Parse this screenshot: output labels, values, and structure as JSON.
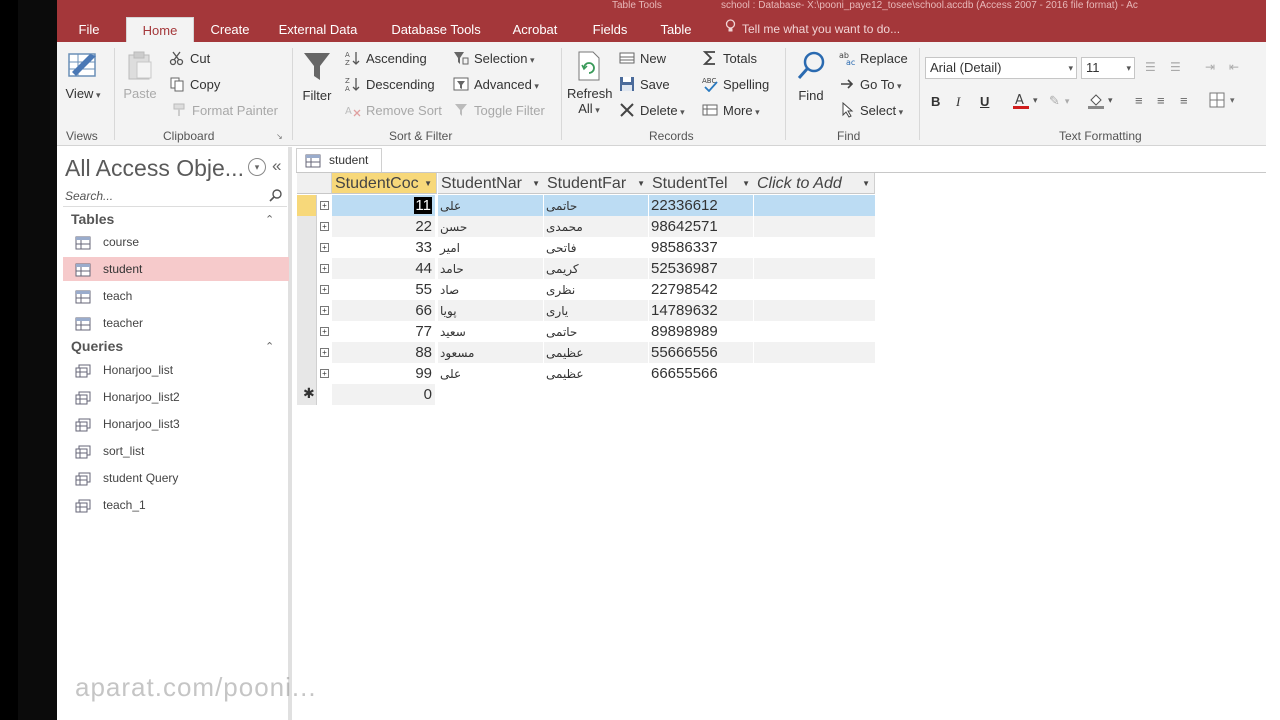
{
  "titlebar": {
    "context_tab_title": "Table Tools",
    "window_title": "school : Database- X:\\pooni_paye12_tosee\\school.accdb (Access 2007 - 2016 file format) - Ac"
  },
  "tabs": [
    "File",
    "Home",
    "Create",
    "External Data",
    "Database Tools",
    "Acrobat",
    "Fields",
    "Table"
  ],
  "active_tab": "Home",
  "tell_me": "Tell me what you want to do...",
  "ribbon": {
    "views": {
      "view": "View",
      "group": "Views"
    },
    "clipboard": {
      "paste": "Paste",
      "cut": "Cut",
      "copy": "Copy",
      "format_painter": "Format Painter",
      "group": "Clipboard"
    },
    "sort_filter": {
      "filter": "Filter",
      "ascending": "Ascending",
      "descending": "Descending",
      "remove_sort": "Remove Sort",
      "selection": "Selection",
      "advanced": "Advanced",
      "toggle_filter": "Toggle Filter",
      "group": "Sort & Filter"
    },
    "records": {
      "refresh": "Refresh",
      "refresh_all": "All",
      "new": "New",
      "save": "Save",
      "delete": "Delete",
      "totals": "Totals",
      "spelling": "Spelling",
      "more": "More",
      "group": "Records"
    },
    "find": {
      "find": "Find",
      "replace": "Replace",
      "goto": "Go To",
      "select": "Select",
      "group": "Find"
    },
    "text_formatting": {
      "font": "Arial (Detail)",
      "size": "11",
      "bold": "B",
      "italic": "I",
      "underline": "U",
      "group": "Text Formatting"
    }
  },
  "nav": {
    "title": "All Access Obje...",
    "search_placeholder": "Search...",
    "tables_header": "Tables",
    "tables": [
      "course",
      "student",
      "teach",
      "teacher"
    ],
    "selected_table": "student",
    "queries_header": "Queries",
    "queries": [
      "Honarjoo_list",
      "Honarjoo_list2",
      "Honarjoo_list3",
      "sort_list",
      "student Query",
      "teach_1"
    ]
  },
  "document_tab": "student",
  "grid": {
    "columns": [
      "StudentCoc",
      "StudentNar",
      "StudentFar",
      "StudentTel",
      "Click to Add"
    ],
    "rows": [
      {
        "code": "11",
        "name": "علی",
        "family": "حاتمی",
        "tel": "22336612"
      },
      {
        "code": "22",
        "name": "حسن",
        "family": "محمدی",
        "tel": "98642571"
      },
      {
        "code": "33",
        "name": "امیر",
        "family": "فاتحی",
        "tel": "98586337"
      },
      {
        "code": "44",
        "name": "حامد",
        "family": "کریمی",
        "tel": "52536987"
      },
      {
        "code": "55",
        "name": "صاد",
        "family": "نظری",
        "tel": "22798542"
      },
      {
        "code": "66",
        "name": "پویا",
        "family": "یاری",
        "tel": "14789632"
      },
      {
        "code": "77",
        "name": "سعید",
        "family": "حاتمی",
        "tel": "89898989"
      },
      {
        "code": "88",
        "name": "مسعود",
        "family": "عظیمی",
        "tel": "55666556"
      },
      {
        "code": "99",
        "name": "علی",
        "family": "عظیمی",
        "tel": "66655566"
      }
    ],
    "new_row_code": "0"
  },
  "watermark": "aparat.com/pooni..."
}
